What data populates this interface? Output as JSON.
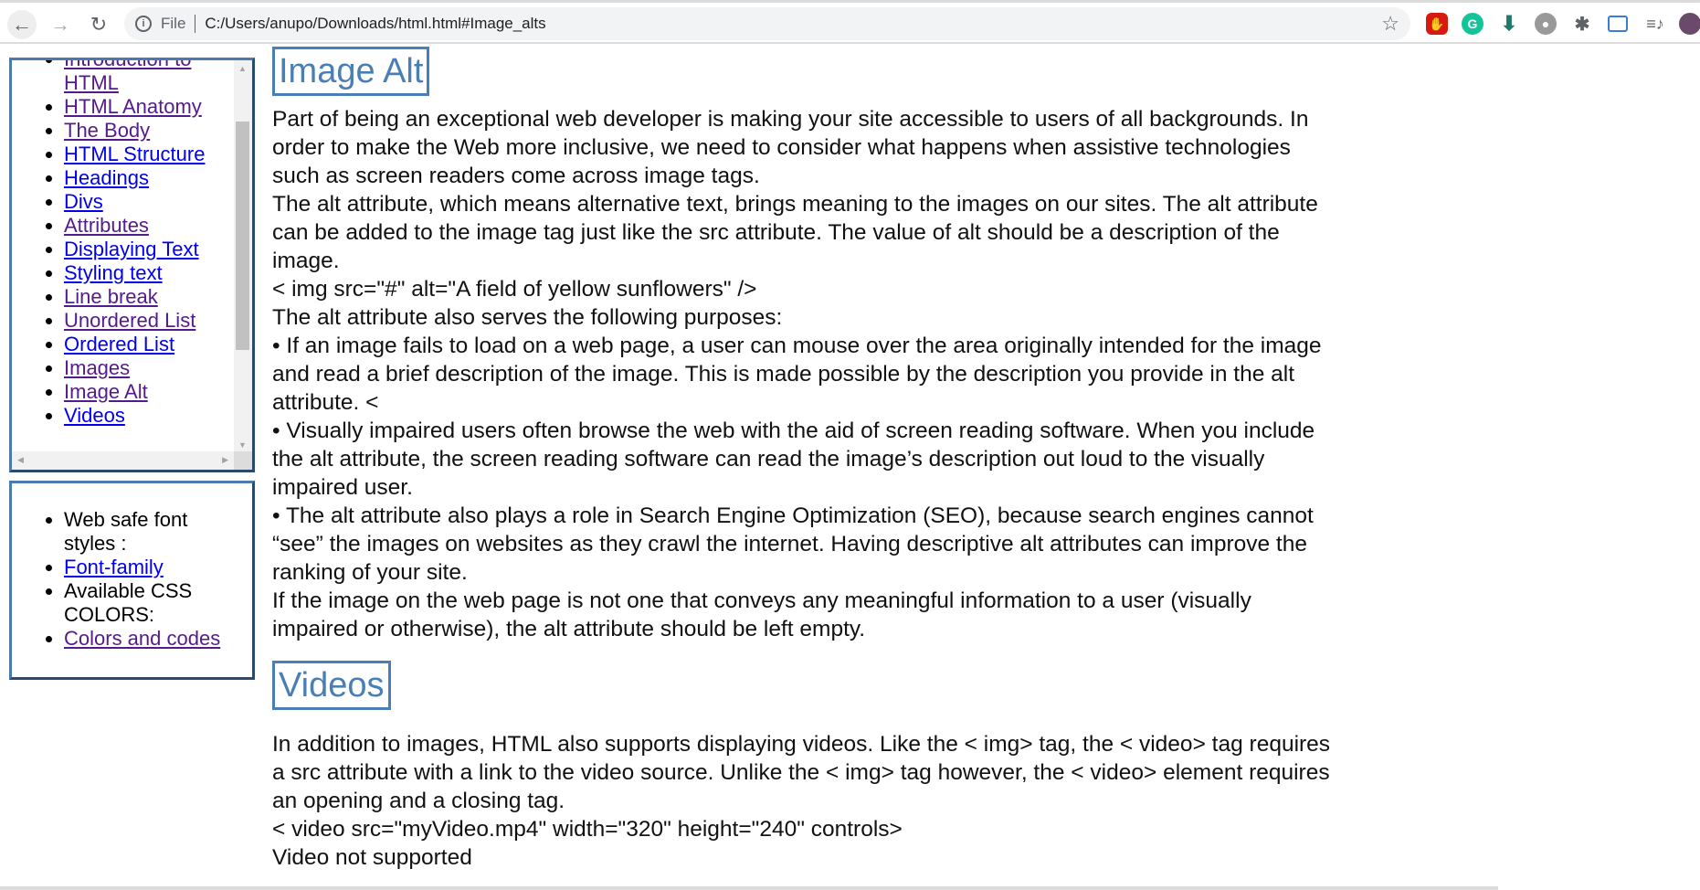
{
  "browser": {
    "url_scheme": "File",
    "url": "C:/Users/anupo/Downloads/html.html#Image_alts"
  },
  "sidebar": {
    "items": [
      {
        "label": "Introduction to",
        "label2": "HTML",
        "visited": true
      },
      {
        "label": "HTML Anatomy",
        "visited": true
      },
      {
        "label": "The Body",
        "visited": true
      },
      {
        "label": "HTML Structure",
        "visited": false
      },
      {
        "label": "Headings",
        "visited": false
      },
      {
        "label": "Divs",
        "visited": false
      },
      {
        "label": "Attributes",
        "visited": true
      },
      {
        "label": "Displaying Text",
        "visited": false
      },
      {
        "label": "Styling text",
        "visited": false
      },
      {
        "label": "Line break",
        "visited": true
      },
      {
        "label": "Unordered List",
        "visited": true
      },
      {
        "label": "Ordered List",
        "visited": false
      },
      {
        "label": "Images",
        "visited": true
      },
      {
        "label": "Image Alt",
        "visited": true
      },
      {
        "label": "Videos",
        "visited": false
      }
    ],
    "extra": {
      "web_safe": "Web safe font",
      "web_safe2": "styles :",
      "font_family": "Font-family",
      "css_colors": "Available CSS",
      "css_colors2": "COLORS:",
      "colors_codes": "Colors and codes"
    }
  },
  "sections": [
    {
      "title": "Image Alt",
      "lines": [
        "Part of being an exceptional web developer is making your site accessible to users of all backgrounds. In",
        "order to make the Web more inclusive, we need to consider what happens when assistive technologies",
        "such as screen readers come across image tags.",
        "The alt attribute, which means alternative text, brings meaning to the images on our sites. The alt attribute",
        "can be added to the image tag just like the src attribute. The value of alt should be a description of the",
        "image.",
        "< img src=\"#\" alt=\"A field of yellow sunflowers\" />",
        "The alt attribute also serves the following purposes:",
        "• If an image fails to load on a web page, a user can mouse over the area originally intended for the image",
        "and read a brief description of the image. This is made possible by the description you provide in the alt",
        "attribute. <",
        "• Visually impaired users often browse the web with the aid of screen reading software. When you include",
        "the alt attribute, the screen reading software can read the image’s description out loud to the visually",
        "impaired user.",
        "• The alt attribute also plays a role in Search Engine Optimization (SEO), because search engines cannot",
        "“see” the images on websites as they crawl the internet. Having descriptive alt attributes can improve the",
        "ranking of your site.",
        "If the image on the web page is not one that conveys any meaningful information to a user (visually",
        "impaired or otherwise), the alt attribute should be left empty."
      ]
    },
    {
      "title": "Videos",
      "lines": [
        "In addition to images, HTML also supports displaying videos. Like the < img> tag, the < video> tag requires",
        "a src attribute with a link to the video source. Unlike the < img> tag however, the < video> element requires",
        "an opening and a closing tag.",
        "< video src=\"myVideo.mp4\" width=\"320\" height=\"240\" controls>",
        "Video not supported"
      ]
    }
  ]
}
